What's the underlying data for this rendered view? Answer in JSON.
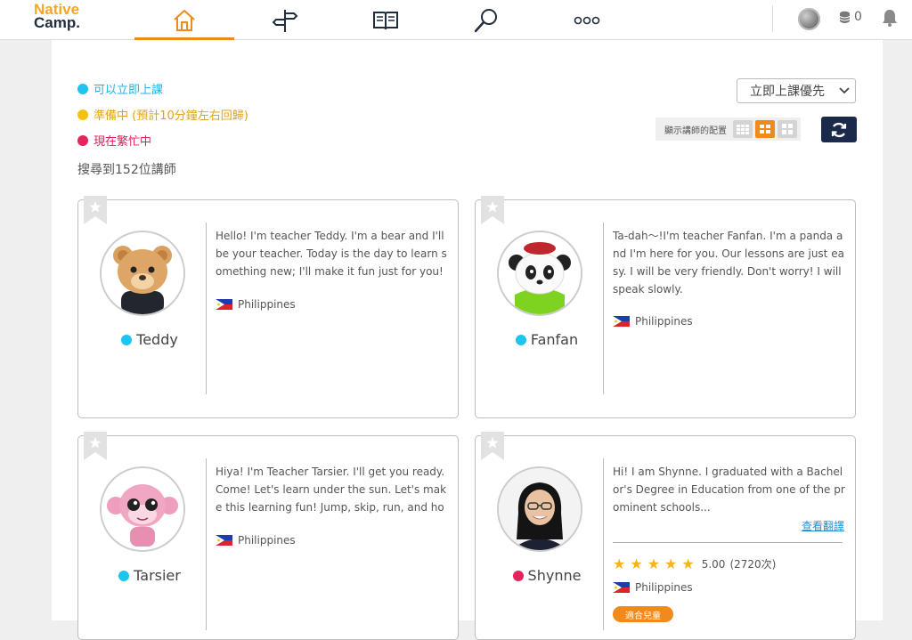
{
  "header": {
    "logo_line1": "Native",
    "logo_line2": "Camp.",
    "nav": [
      {
        "icon": "home-icon",
        "active": true
      },
      {
        "icon": "signpost-icon",
        "active": false
      },
      {
        "icon": "book-icon",
        "active": false
      },
      {
        "icon": "search-icon",
        "active": false
      },
      {
        "icon": "more-icon",
        "active": false
      }
    ],
    "coins": "0"
  },
  "legend": {
    "available": "可以立即上課",
    "preparing": "準備中 (預計10分鐘左右回歸)",
    "busy": "現在繁忙中"
  },
  "results": {
    "count_text": "搜尋到152位講師"
  },
  "sort": {
    "selected": "立即上課優先"
  },
  "layout_toggle": {
    "label": "顯示講師的配置"
  },
  "colors": {
    "accent": "#f08a1c",
    "available": "#1ec4f0",
    "busy": "#e4245b",
    "navy": "#1b2a4a"
  },
  "teachers": [
    {
      "name": "Teddy",
      "status": "available",
      "intro": "Hello! I'm teacher Teddy. I'm a bear and I'll be your teacher. Today is the day to learn something new; I'll make it fun just for you! In my class",
      "country": "Philippines"
    },
    {
      "name": "Fanfan",
      "status": "available",
      "intro": "Ta-dah～!I'm teacher Fanfan. I'm a panda and I'm here for you. Our lessons are just easy. I will be very friendly. Don't worry! I will speak slowly.",
      "country": "Philippines"
    },
    {
      "name": "Tarsier",
      "status": "available",
      "intro": "Hiya! I'm Teacher Tarsier. I'll get you ready. Come! Let's learn under the sun. Let's make this learning fun! Jump, skip, run, and hop. I'll help yo",
      "country": "Philippines"
    },
    {
      "name": "Shynne",
      "status": "busy",
      "intro": "Hi! I am Shynne. I graduated with a Bachelor's Degree in Education from one of the prominent schools...",
      "more_link": "查看翻譯",
      "rating": "5.00",
      "rating_count": "(2720次)",
      "country": "Philippines",
      "badge": "適合兒童"
    }
  ]
}
